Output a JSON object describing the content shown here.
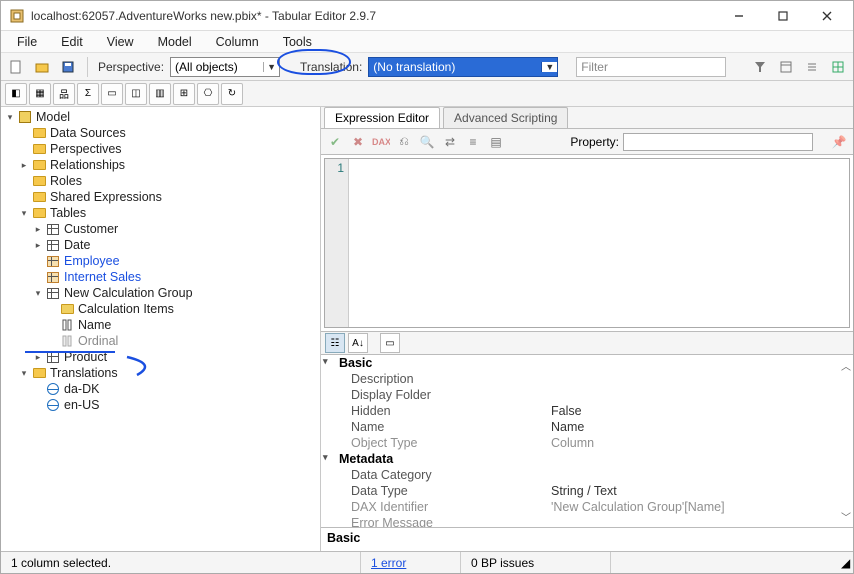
{
  "title": "localhost:62057.AdventureWorks new.pbix* - Tabular Editor 2.9.7",
  "menus": [
    "File",
    "Edit",
    "View",
    "Model",
    "Column",
    "Tools"
  ],
  "perspective_label": "Perspective:",
  "perspective_value": "(All objects)",
  "translation_label": "Translation:",
  "translation_value": "(No translation)",
  "filter_placeholder": "Filter",
  "tree": {
    "root": "Model",
    "items": [
      "Data Sources",
      "Perspectives",
      "Relationships",
      "Roles",
      "Shared Expressions"
    ],
    "tables_label": "Tables",
    "tables": [
      "Customer",
      "Date",
      "Employee",
      "Internet Sales"
    ],
    "calcgroup": "New Calculation Group",
    "calcgroup_children": [
      "Calculation Items",
      "Name",
      "Ordinal"
    ],
    "product": "Product",
    "translations_label": "Translations",
    "translations": [
      "da-DK",
      "en-US"
    ]
  },
  "tabs": {
    "expr": "Expression Editor",
    "adv": "Advanced Scripting"
  },
  "editor": {
    "line": "1",
    "property_label": "Property:"
  },
  "props": {
    "cat1": "Basic",
    "rows1": [
      {
        "k": "Description",
        "v": ""
      },
      {
        "k": "Display Folder",
        "v": ""
      },
      {
        "k": "Hidden",
        "v": "False"
      },
      {
        "k": "Name",
        "v": "Name"
      },
      {
        "k": "Object Type",
        "v": "Column",
        "gray": true
      }
    ],
    "cat2": "Metadata",
    "rows2": [
      {
        "k": "Data Category",
        "v": ""
      },
      {
        "k": "Data Type",
        "v": "String / Text"
      },
      {
        "k": "DAX Identifier",
        "v": "'New Calculation Group'[Name]",
        "gray": true
      },
      {
        "k": "Error Message",
        "v": "",
        "gray": true
      }
    ]
  },
  "desc_title": "Basic",
  "status": {
    "sel": "1 column selected.",
    "err": "1 error",
    "bp": "0 BP issues"
  }
}
